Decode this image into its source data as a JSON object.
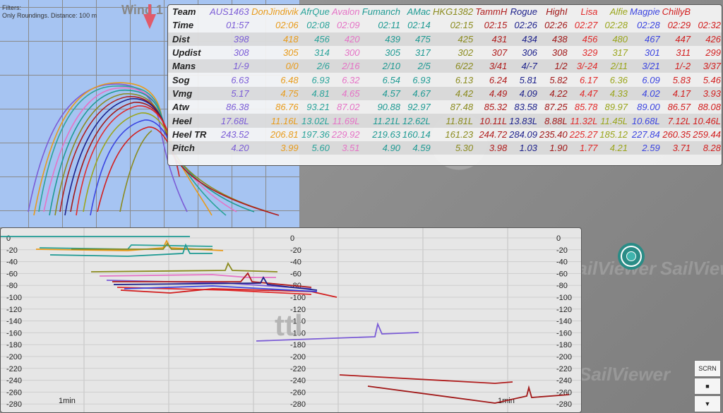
{
  "map": {
    "filters_line1": "Filters:",
    "filters_line2": "Only Roundings. Distance: 100 m",
    "wind_label": "Wind 1"
  },
  "table": {
    "header_label": "Team",
    "teams": [
      {
        "name": "AUS1463",
        "color": "#7b5cd6"
      },
      {
        "name": "DonJindivik",
        "color": "#e89b1b"
      },
      {
        "name": "AfrQue",
        "color": "#2aa39a"
      },
      {
        "name": "Avalon",
        "color": "#e573c6"
      },
      {
        "name": "Fumanch",
        "color": "#1e9a93"
      },
      {
        "name": "AMac",
        "color": "#1e9a93"
      },
      {
        "name": "HKG1382",
        "color": "#8b8b1e"
      },
      {
        "name": "TammH",
        "color": "#b01c1c"
      },
      {
        "name": "Rogue",
        "color": "#1b1f8a"
      },
      {
        "name": "HighI",
        "color": "#a11818"
      },
      {
        "name": "Lisa",
        "color": "#e12a2a"
      },
      {
        "name": "Alfie",
        "color": "#9aa51b"
      },
      {
        "name": "Magpie",
        "color": "#3b44e0"
      },
      {
        "name": "ChillyB",
        "color": "#d21e1e"
      }
    ],
    "rows": [
      {
        "label": "Time",
        "values": [
          "01:57",
          "02:06",
          "02:08",
          "02:09",
          "02:11",
          "02:14",
          "02:15",
          "02:15",
          "02:26",
          "02:26",
          "02:27",
          "02:28",
          "02:28",
          "02:29",
          "02:32"
        ]
      },
      {
        "label": "Dist",
        "values": [
          "398",
          "418",
          "456",
          "420",
          "439",
          "475",
          "425",
          "431",
          "434",
          "438",
          "456",
          "480",
          "467",
          "447",
          "426"
        ]
      },
      {
        "label": "Updist",
        "values": [
          "308",
          "305",
          "314",
          "300",
          "305",
          "317",
          "302",
          "307",
          "306",
          "308",
          "329",
          "317",
          "301",
          "311",
          "299"
        ]
      },
      {
        "label": "Mans",
        "values": [
          "1/-9",
          "0/0",
          "2/6",
          "2/16",
          "2/10",
          "2/5",
          "6/22",
          "3/41",
          "4/-7",
          "1/2",
          "3/-24",
          "2/11",
          "3/21",
          "1/-2",
          "3/37"
        ]
      },
      {
        "label": "Sog",
        "values": [
          "6.63",
          "6.48",
          "6.93",
          "6.32",
          "6.54",
          "6.93",
          "6.13",
          "6.24",
          "5.81",
          "5.82",
          "6.17",
          "6.36",
          "6.09",
          "5.83",
          "5.46"
        ]
      },
      {
        "label": "Vmg",
        "values": [
          "5.17",
          "4.75",
          "4.81",
          "4.65",
          "4.57",
          "4.67",
          "4.42",
          "4.49",
          "4.09",
          "4.22",
          "4.47",
          "4.33",
          "4.02",
          "4.17",
          "3.93"
        ]
      },
      {
        "label": "Atw",
        "values": [
          "86.38",
          "86.76",
          "93.21",
          "87.02",
          "90.88",
          "92.97",
          "87.48",
          "85.32",
          "83.58",
          "87.25",
          "85.78",
          "89.97",
          "89.00",
          "86.57",
          "88.08"
        ]
      },
      {
        "label": "Heel",
        "values": [
          "17.68L",
          "11.16L",
          "13.02L",
          "11.69L",
          "11.21L",
          "12.62L",
          "11.81L",
          "10.11L",
          "13.83L",
          "8.88L",
          "11.32L",
          "11.45L",
          "10.68L",
          "7.12L",
          "10.46L"
        ]
      },
      {
        "label": "Heel TR",
        "values": [
          "243.52",
          "206.81",
          "197.36",
          "229.92",
          "219.63",
          "160.14",
          "161.23",
          "244.72",
          "284.09",
          "235.40",
          "225.27",
          "185.12",
          "227.84",
          "260.35",
          "259.44"
        ]
      },
      {
        "label": "Pitch",
        "values": [
          "4.20",
          "3.99",
          "5.60",
          "3.51",
          "4.90",
          "4.59",
          "5.30",
          "3.98",
          "1.03",
          "1.90",
          "1.77",
          "4.21",
          "2.59",
          "3.71",
          "8.28"
        ]
      }
    ]
  },
  "chart": {
    "overlay_text": "ttl",
    "x_label_left": "1min",
    "x_label_right": "1min",
    "y_ticks": [
      "0",
      "-20",
      "-40",
      "-60",
      "-80",
      "-100",
      "-120",
      "-140",
      "-160",
      "-180",
      "-200",
      "-220",
      "-240",
      "-260",
      "-280"
    ]
  },
  "watermark": [
    "SailViewer",
    "SailViewer",
    "SailViewer"
  ],
  "controls": {
    "scrn_label": "SCRN"
  }
}
